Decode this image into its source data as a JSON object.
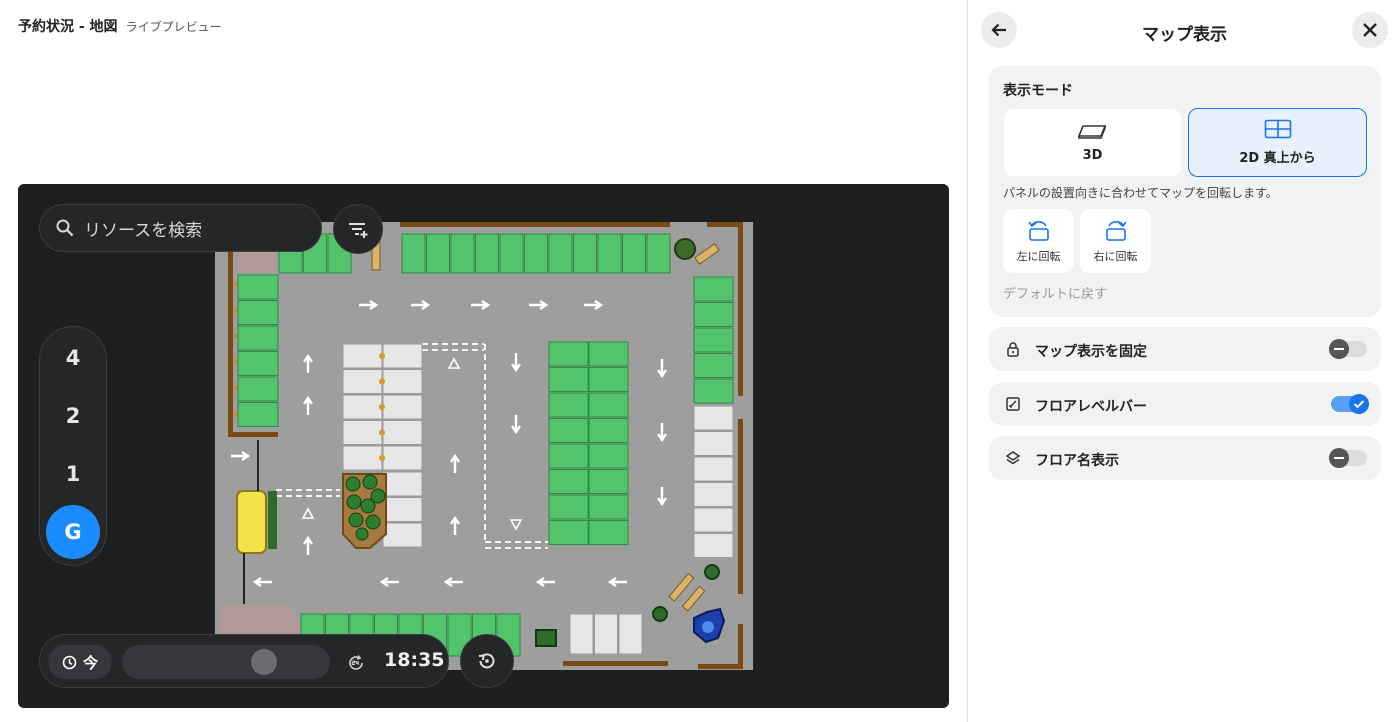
{
  "page": {
    "title": "予約状況 - 地図",
    "subtitle": "ライブプレビュー"
  },
  "map": {
    "search_placeholder": "リソースを検索",
    "floors": [
      "4",
      "2",
      "1",
      "G"
    ],
    "active_floor": "G",
    "time": {
      "now_label": "今",
      "value": "18:35",
      "slider_fraction": 0.72
    }
  },
  "panel": {
    "title": "マップ表示",
    "display_mode": {
      "label": "表示モード",
      "options": [
        "3D",
        "2D 真上から"
      ],
      "selected": "2D 真上から",
      "hint": "パネルの設置向きに合わせてマップを回転します。",
      "rotate_left": "左に回転",
      "rotate_right": "右に回転",
      "reset": "デフォルトに戻す"
    },
    "toggles": [
      {
        "label": "マップ表示を固定",
        "icon": "lock-icon",
        "on": false
      },
      {
        "label": "フロアレベルバー",
        "icon": "edit-square-icon",
        "on": true
      },
      {
        "label": "フロア名表示",
        "icon": "layers-icon",
        "on": false
      }
    ]
  },
  "colors": {
    "accent": "#1a8cff",
    "map_background": "#1e1f21",
    "parking_free": "#52c46b",
    "parking_busy": "#e6e6e6",
    "floor_gray": "#9e9e9e"
  }
}
